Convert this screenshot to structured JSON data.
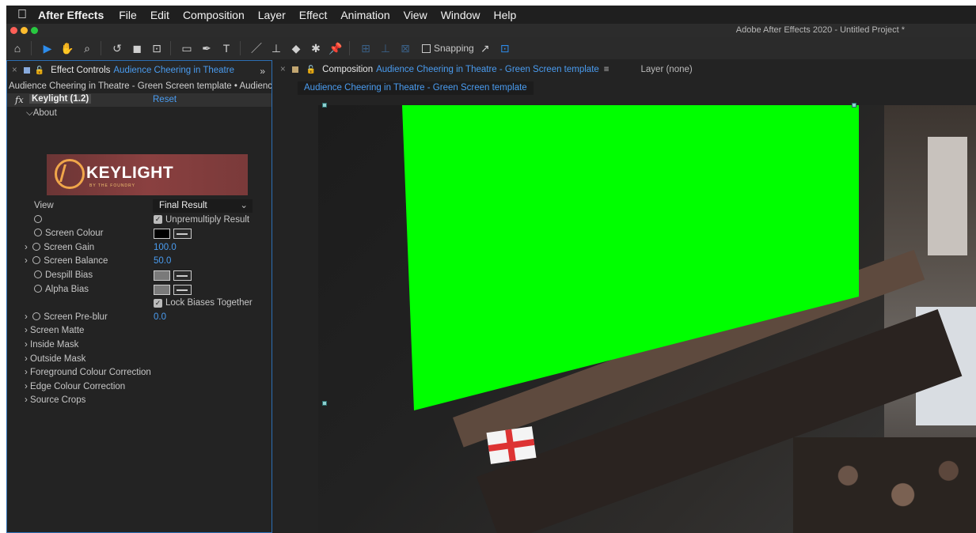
{
  "menubar": {
    "apple": "",
    "app": "After Effects",
    "items": [
      "File",
      "Edit",
      "Composition",
      "Layer",
      "Effect",
      "Animation",
      "View",
      "Window",
      "Help"
    ]
  },
  "window": {
    "title": "Adobe After Effects 2020 - Untitled Project *"
  },
  "toolbar": {
    "snapping_label": "Snapping"
  },
  "effect_controls": {
    "tab_title": "Effect Controls",
    "tab_comp": "Audience Cheering in Theatre",
    "more": "»",
    "subtitle": "Audience Cheering in Theatre - Green Screen template • Audience",
    "effect_name": "Keylight (1.2)",
    "fx_label": "fx",
    "reset_label": "Reset",
    "about_label": "About",
    "logo_text": "KEYLIGHT",
    "logo_sub": "BY THE FOUNDRY",
    "params": {
      "view_label": "View",
      "view_value": "Final Result",
      "unpremultiply_label": "Unpremultiply Result",
      "screen_colour_label": "Screen Colour",
      "screen_gain_label": "Screen Gain",
      "screen_gain_value": "100.0",
      "screen_balance_label": "Screen Balance",
      "screen_balance_value": "50.0",
      "despill_bias_label": "Despill Bias",
      "alpha_bias_label": "Alpha Bias",
      "lock_biases_label": "Lock Biases Together",
      "screen_preblur_label": "Screen Pre-blur",
      "screen_preblur_value": "0.0"
    },
    "groups": [
      "Screen Matte",
      "Inside Mask",
      "Outside Mask",
      "Foreground Colour Correction",
      "Edge Colour Correction",
      "Source Crops"
    ]
  },
  "composition": {
    "tab_title": "Composition",
    "tab_comp": "Audience Cheering in Theatre - Green Screen template",
    "menu_icon": "≡",
    "layer_tab": "Layer (none)",
    "comp_name_pill": "Audience Cheering in Theatre - Green Screen template",
    "green_screen_color": "#00ff00"
  },
  "colors": {
    "accent": "#4a9cf0",
    "panel_bg": "#232323"
  }
}
